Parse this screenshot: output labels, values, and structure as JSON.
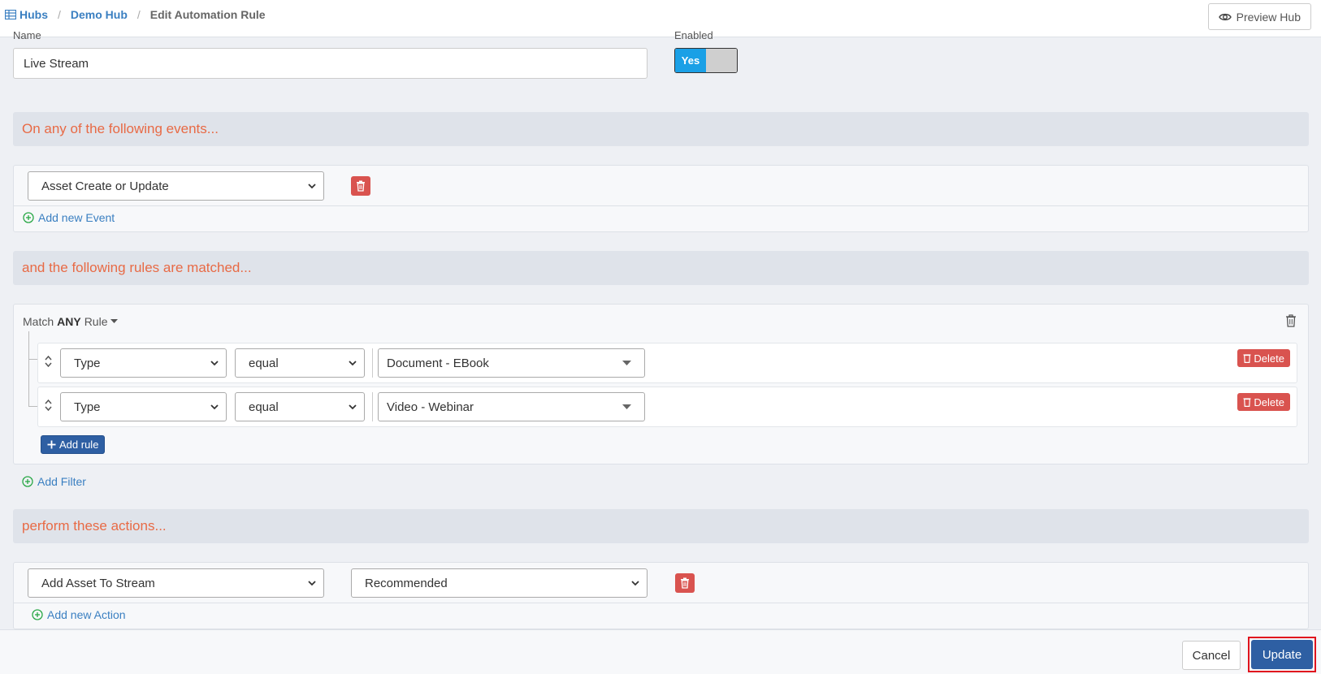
{
  "breadcrumb": {
    "hubs": "Hubs",
    "hub": "Demo Hub",
    "current": "Edit Automation Rule"
  },
  "preview_label": "Preview Hub",
  "name_field": {
    "label": "Name",
    "value": "Live Stream"
  },
  "enabled_field": {
    "label": "Enabled",
    "on_label": "Yes"
  },
  "events": {
    "header": "On any of the following events...",
    "items": [
      {
        "value": "Asset Create or Update"
      }
    ],
    "add_label": "Add new Event"
  },
  "rules": {
    "header": "and the following rules are matched...",
    "match_prefix": "Match",
    "match_mode": "ANY",
    "match_suffix": "Rule",
    "items": [
      {
        "field": "Type",
        "operator": "equal",
        "value": "Document - EBook",
        "delete_label": "Delete"
      },
      {
        "field": "Type",
        "operator": "equal",
        "value": "Video - Webinar",
        "delete_label": "Delete"
      }
    ],
    "add_rule_label": "Add rule",
    "add_filter_label": "Add Filter"
  },
  "actions": {
    "header": "perform these actions...",
    "items": [
      {
        "action": "Add Asset To Stream",
        "target": "Recommended"
      }
    ],
    "add_label": "Add new Action"
  },
  "footer": {
    "cancel_label": "Cancel",
    "update_label": "Update"
  },
  "colors": {
    "accent": "#e86a45",
    "primary": "#2e5fa3",
    "danger": "#d9534f",
    "toggle_on": "#1aa0e6",
    "link": "#3a7fc1",
    "highlight": "#e0141e"
  }
}
